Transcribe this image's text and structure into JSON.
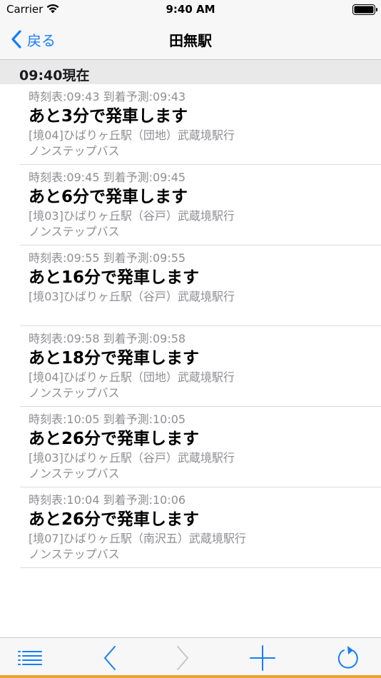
{
  "status_bar": {
    "carrier": "Carrier",
    "time": "9:40 AM"
  },
  "nav": {
    "back_label": "戻る",
    "title": "田無駅"
  },
  "section": {
    "label": "09:40現在"
  },
  "departures": [
    {
      "schedule": "時刻表:09:43 到着予測:09:43",
      "main": "あと3分で発車します",
      "route": "[境04]ひばりヶ丘駅（団地）武蔵境駅行",
      "type": "ノンステップバス"
    },
    {
      "schedule": "時刻表:09:45 到着予測:09:45",
      "main": "あと6分で発車します",
      "route": "[境03]ひばりヶ丘駅（谷戸）武蔵境駅行",
      "type": "ノンステップバス"
    },
    {
      "schedule": "時刻表:09:55 到着予測:09:55",
      "main": "あと16分で発車します",
      "route": "[境03]ひばりヶ丘駅（谷戸）武蔵境駅行",
      "type": ""
    },
    {
      "schedule": "時刻表:09:58 到着予測:09:58",
      "main": "あと18分で発車します",
      "route": "[境04]ひばりヶ丘駅（団地）武蔵境駅行",
      "type": "ノンステップバス"
    },
    {
      "schedule": "時刻表:10:05 到着予測:10:05",
      "main": "あと26分で発車します",
      "route": "[境03]ひばりヶ丘駅（谷戸）武蔵境駅行",
      "type": "ノンステップバス"
    },
    {
      "schedule": "時刻表:10:04 到着予測:10:06",
      "main": "あと26分で発車します",
      "route": "[境07]ひばりヶ丘駅（南沢五）武蔵境駅行",
      "type": "ノンステップバス"
    }
  ],
  "toolbar": {
    "icons": [
      "list-icon",
      "chevron-left-icon",
      "chevron-right-icon",
      "plus-icon",
      "refresh-icon"
    ]
  },
  "colors": {
    "accent": "#147efb",
    "disabled": "#c7c7cc",
    "secondary_text": "#8e8e93",
    "section_bg": "#e9e9ea",
    "bottom_accent": "#f0a030"
  }
}
